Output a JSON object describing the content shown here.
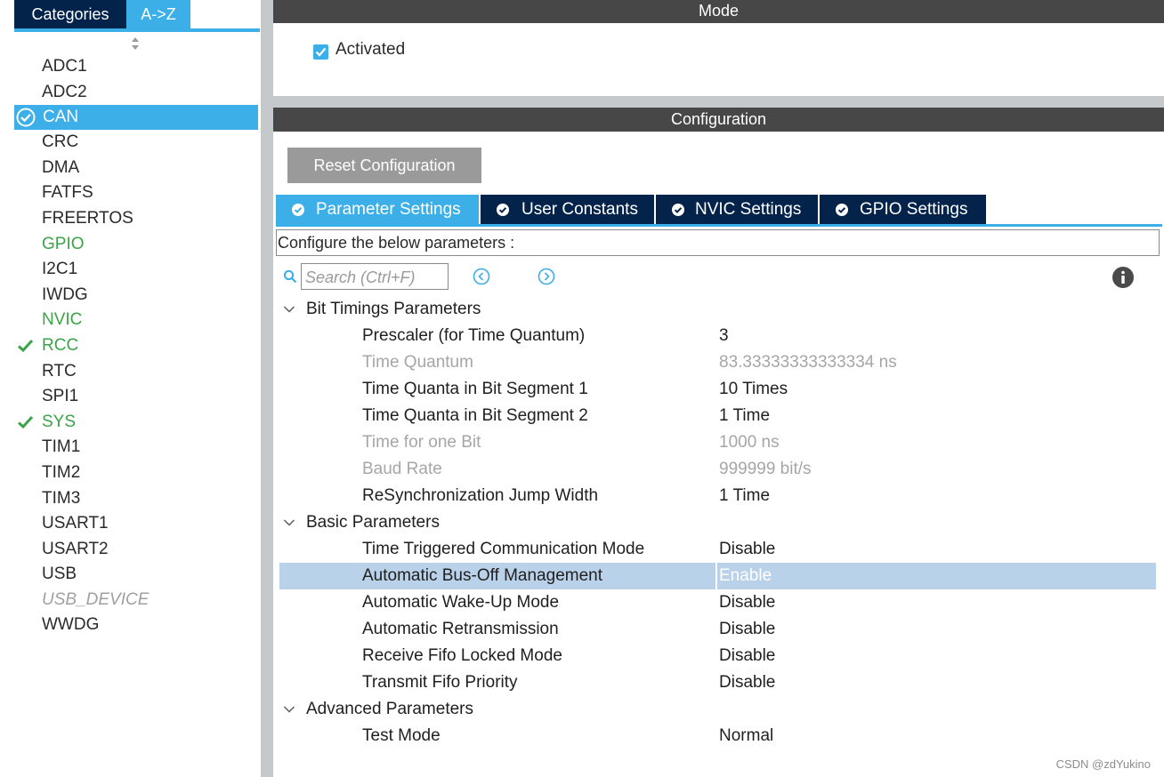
{
  "left_panel": {
    "tabs": {
      "categories": "Categories",
      "az": "A->Z"
    },
    "items": [
      {
        "label": "ADC1",
        "state": "normal"
      },
      {
        "label": "ADC2",
        "state": "normal"
      },
      {
        "label": "CAN",
        "state": "selected",
        "icon": "check-circle-icon"
      },
      {
        "label": "CRC",
        "state": "normal"
      },
      {
        "label": "DMA",
        "state": "normal"
      },
      {
        "label": "FATFS",
        "state": "normal"
      },
      {
        "label": "FREERTOS",
        "state": "normal"
      },
      {
        "label": "GPIO",
        "state": "green"
      },
      {
        "label": "I2C1",
        "state": "normal"
      },
      {
        "label": "IWDG",
        "state": "normal"
      },
      {
        "label": "NVIC",
        "state": "green"
      },
      {
        "label": "RCC",
        "state": "green",
        "icon": "check-icon"
      },
      {
        "label": "RTC",
        "state": "normal"
      },
      {
        "label": "SPI1",
        "state": "normal"
      },
      {
        "label": "SYS",
        "state": "green",
        "icon": "check-icon"
      },
      {
        "label": "TIM1",
        "state": "normal"
      },
      {
        "label": "TIM2",
        "state": "normal"
      },
      {
        "label": "TIM3",
        "state": "normal"
      },
      {
        "label": "USART1",
        "state": "normal"
      },
      {
        "label": "USART2",
        "state": "normal"
      },
      {
        "label": "USB",
        "state": "normal"
      },
      {
        "label": "USB_DEVICE",
        "state": "disabled"
      },
      {
        "label": "WWDG",
        "state": "normal"
      }
    ]
  },
  "mode": {
    "title": "Mode",
    "activated_label": "Activated",
    "activated_checked": true
  },
  "configuration": {
    "title": "Configuration",
    "reset_label": "Reset Configuration",
    "tabs": [
      {
        "label": "Parameter Settings",
        "active": true
      },
      {
        "label": "User Constants",
        "active": false
      },
      {
        "label": "NVIC Settings",
        "active": false
      },
      {
        "label": "GPIO Settings",
        "active": false
      }
    ],
    "configure_text": "Configure the below parameters :",
    "search_placeholder": "Search (Ctrl+F)"
  },
  "params": [
    {
      "type": "group",
      "label": "Bit Timings Parameters"
    },
    {
      "type": "param",
      "name": "Prescaler (for Time Quantum)",
      "value": "3",
      "greyed": false
    },
    {
      "type": "param",
      "name": "Time Quantum",
      "value": "83.33333333333334 ns",
      "greyed": true
    },
    {
      "type": "param",
      "name": "Time Quanta in Bit Segment 1",
      "value": "10 Times",
      "greyed": false
    },
    {
      "type": "param",
      "name": "Time Quanta in Bit Segment 2",
      "value": "1 Time",
      "greyed": false
    },
    {
      "type": "param",
      "name": "Time for one Bit",
      "value": "1000 ns",
      "greyed": true
    },
    {
      "type": "param",
      "name": "Baud Rate",
      "value": "999999 bit/s",
      "greyed": true
    },
    {
      "type": "param",
      "name": "ReSynchronization Jump Width",
      "value": "1 Time",
      "greyed": false
    },
    {
      "type": "group",
      "label": "Basic Parameters"
    },
    {
      "type": "param",
      "name": "Time Triggered Communication Mode",
      "value": "Disable",
      "greyed": false
    },
    {
      "type": "param",
      "name": "Automatic Bus-Off Management",
      "value": "Enable",
      "greyed": false,
      "highlighted": true
    },
    {
      "type": "param",
      "name": "Automatic Wake-Up Mode",
      "value": "Disable",
      "greyed": false
    },
    {
      "type": "param",
      "name": "Automatic Retransmission",
      "value": "Disable",
      "greyed": false
    },
    {
      "type": "param",
      "name": "Receive Fifo Locked Mode",
      "value": "Disable",
      "greyed": false
    },
    {
      "type": "param",
      "name": "Transmit Fifo Priority",
      "value": "Disable",
      "greyed": false
    },
    {
      "type": "group",
      "label": "Advanced Parameters"
    },
    {
      "type": "param",
      "name": "Test Mode",
      "value": "Normal",
      "greyed": false
    }
  ],
  "watermark": "CSDN @zdYukino",
  "colors": {
    "accent": "#3caee8",
    "dark_tab": "#03234b",
    "header": "#474747",
    "green": "#3aa447",
    "highlight_row": "#b9d1e9"
  }
}
